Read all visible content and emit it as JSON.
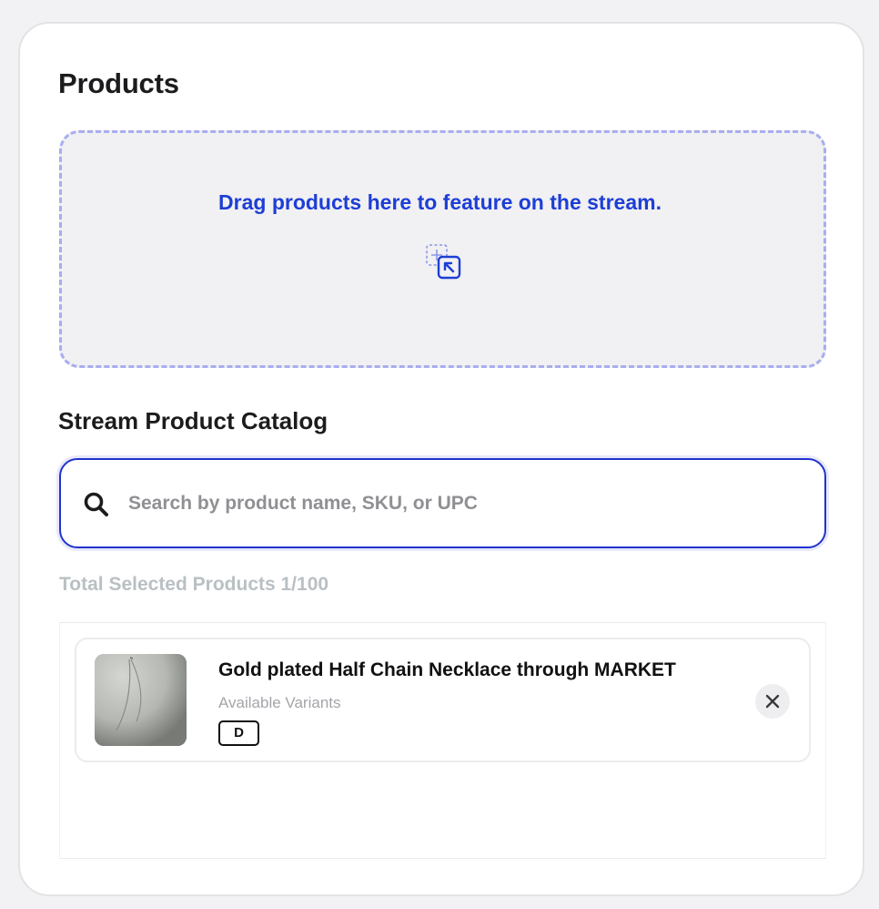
{
  "header": {
    "title": "Products"
  },
  "dropzone": {
    "text": "Drag products here to feature on the stream.",
    "icon": "drag-drop-icon"
  },
  "catalog": {
    "title": "Stream Product Catalog",
    "search": {
      "placeholder": "Search by product name, SKU, or UPC",
      "value": "",
      "icon": "search-icon"
    },
    "total_selected": "Total Selected Products 1/100",
    "products": [
      {
        "name": "Gold plated Half Chain Necklace through MARKET",
        "variants_label": "Available Variants",
        "variants": [
          "D"
        ],
        "remove_icon": "close-icon"
      }
    ]
  },
  "colors": {
    "accent": "#1d3ed6",
    "dropzone_border": "#a9adef",
    "search_border": "#2233cc"
  }
}
